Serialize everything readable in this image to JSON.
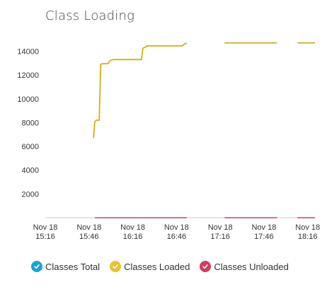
{
  "title": "Class Loading",
  "chart_data": {
    "type": "line",
    "ylim": [
      0,
      15000
    ],
    "yticks": [
      2000,
      4000,
      6000,
      8000,
      10000,
      12000,
      14000
    ],
    "xlim": [
      "Nov 18 15:16",
      "Nov 18 18:21"
    ],
    "x_ticks": [
      {
        "line1": "Nov 18",
        "line2": "15:16",
        "t": "15:16"
      },
      {
        "line1": "Nov 18",
        "line2": "15:46",
        "t": "15:46"
      },
      {
        "line1": "Nov 18",
        "line2": "16:16",
        "t": "16:16"
      },
      {
        "line1": "Nov 18",
        "line2": "16:46",
        "t": "16:46"
      },
      {
        "line1": "Nov 18",
        "line2": "17:16",
        "t": "17:16"
      },
      {
        "line1": "Nov 18",
        "line2": "17:46",
        "t": "17:46"
      },
      {
        "line1": "Nov 18",
        "line2": "18:16",
        "t": "18:16"
      }
    ],
    "grid": false,
    "legend_position": "bottom",
    "series": [
      {
        "name": "Classes Total",
        "color": "#1aa3d8",
        "segments": []
      },
      {
        "name": "Classes Loaded",
        "color": "#e8c22c",
        "segments": [
          {
            "x": [
              "15:49",
              "15:50",
              "15:51",
              "15:52",
              "15:53",
              "15:54",
              "15:55",
              "15:57",
              "15:59",
              "16:00",
              "16:01",
              "16:03",
              "16:06",
              "16:10",
              "16:16",
              "16:22",
              "16:23",
              "16:24",
              "16:26",
              "16:30",
              "16:40",
              "16:50",
              "16:51",
              "16:52",
              "16:53"
            ],
            "y": [
              6700,
              8050,
              8200,
              8200,
              8200,
              12900,
              12950,
              12950,
              12950,
              13150,
              13250,
              13300,
              13300,
              13300,
              13300,
              13300,
              14250,
              14300,
              14450,
              14450,
              14450,
              14450,
              14550,
              14650,
              14650
            ]
          },
          {
            "x": [
              "17:19",
              "17:55"
            ],
            "y": [
              14700,
              14700
            ]
          },
          {
            "x": [
              "18:09",
              "18:21"
            ],
            "y": [
              14700,
              14700
            ]
          }
        ]
      },
      {
        "name": "Classes Unloaded",
        "color": "#d63b5a",
        "segments": [
          {
            "x": [
              "15:50",
              "16:53"
            ],
            "y": [
              0,
              0
            ]
          },
          {
            "x": [
              "17:19",
              "17:55"
            ],
            "y": [
              0,
              0
            ]
          },
          {
            "x": [
              "18:09",
              "18:21"
            ],
            "y": [
              0,
              0
            ]
          }
        ]
      }
    ]
  },
  "legend": [
    {
      "label": "Classes Total",
      "color": "#1aa3d8"
    },
    {
      "label": "Classes Loaded",
      "color": "#e8c22c"
    },
    {
      "label": "Classes Unloaded",
      "color": "#d63b5a"
    }
  ]
}
